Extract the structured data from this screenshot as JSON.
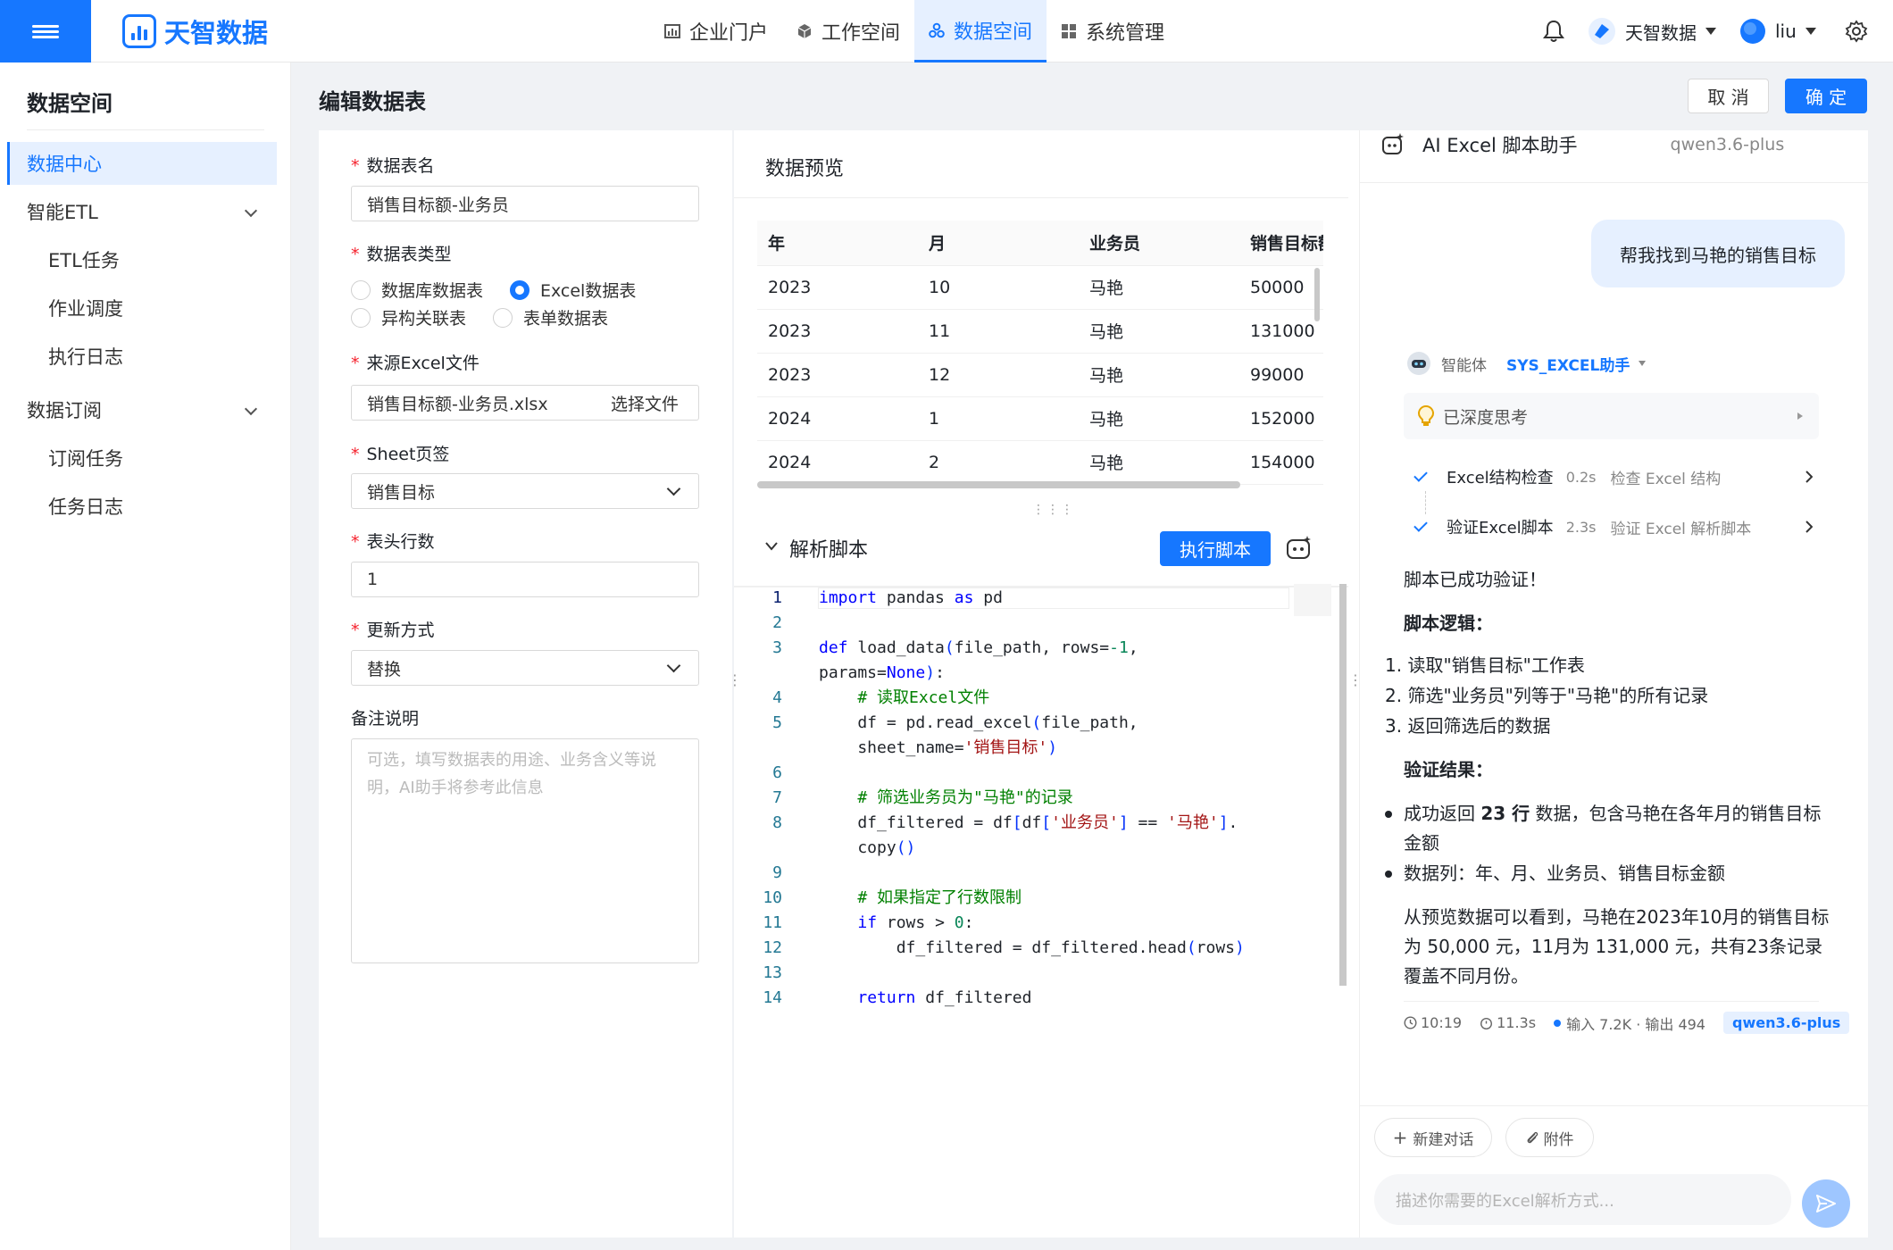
{
  "brand": {
    "name": "天智数据"
  },
  "nav": {
    "items": [
      {
        "label": "企业门户",
        "icon": "chart-bar-icon"
      },
      {
        "label": "工作空间",
        "icon": "cube-icon"
      },
      {
        "label": "数据空间",
        "icon": "cluster-icon",
        "active": true
      },
      {
        "label": "系统管理",
        "icon": "grid-icon"
      }
    ]
  },
  "header": {
    "org": "天智数据",
    "user": "liu"
  },
  "sidebar": {
    "title": "数据空间",
    "items": [
      {
        "label": "数据中心"
      },
      {
        "label": "智能ETL"
      },
      {
        "label": "ETL任务"
      },
      {
        "label": "作业调度"
      },
      {
        "label": "执行日志"
      },
      {
        "label": "数据订阅"
      },
      {
        "label": "订阅任务"
      },
      {
        "label": "任务日志"
      }
    ]
  },
  "page": {
    "title": "编辑数据表",
    "cancel": "取 消",
    "confirm": "确 定"
  },
  "form": {
    "name_label": "数据表名",
    "name_value": "销售目标额-业务员",
    "type_label": "数据表类型",
    "types": [
      "数据库数据表",
      "Excel数据表",
      "异构关联表",
      "表单数据表"
    ],
    "selected_type": "Excel数据表",
    "file_label": "来源Excel文件",
    "file_value": "销售目标额-业务员.xlsx",
    "file_button": "选择文件",
    "sheet_label": "Sheet页签",
    "sheet_value": "销售目标",
    "header_rows_label": "表头行数",
    "header_rows_value": "1",
    "update_label": "更新方式",
    "update_value": "替换",
    "remark_label": "备注说明",
    "remark_placeholder": "可选，填写数据表的用途、业务含义等说明，AI助手将参考此信息"
  },
  "preview": {
    "title": "数据预览",
    "columns": [
      "年",
      "月",
      "业务员",
      "销售目标额"
    ],
    "rows": [
      [
        "2023",
        "10",
        "马艳",
        "50000"
      ],
      [
        "2023",
        "11",
        "马艳",
        "131000"
      ],
      [
        "2023",
        "12",
        "马艳",
        "99000"
      ],
      [
        "2024",
        "1",
        "马艳",
        "152000"
      ],
      [
        "2024",
        "2",
        "马艳",
        "154000"
      ]
    ]
  },
  "script": {
    "title": "解析脚本",
    "run_button": "执行脚本",
    "lines": [
      "import pandas as pd",
      "",
      "def load_data(file_path, rows=-1, params=None):",
      "    # 读取Excel文件",
      "    df = pd.read_excel(file_path, sheet_name='销售目标')",
      "",
      "    # 筛选业务员为\"马艳\"的记录",
      "    df_filtered = df[df['业务员'] == '马艳'].copy()",
      "",
      "    # 如果指定了行数限制",
      "    if rows > 0:",
      "        df_filtered = df_filtered.head(rows)",
      "",
      "    return df_filtered"
    ]
  },
  "assistant": {
    "title": "AI Excel 脚本助手",
    "model": "qwen3.6-plus",
    "user_message": "帮我找到马艳的销售目标",
    "agent_label": "智能体",
    "agent_name": "SYS_EXCEL助手",
    "thinking": "已深度思考",
    "steps": [
      {
        "name": "Excel结构检查",
        "time": "0.2s",
        "desc": "检查 Excel 结构"
      },
      {
        "name": "验证Excel脚本",
        "time": "2.3s",
        "desc": "验证 Excel 解析脚本"
      }
    ],
    "success": "脚本已成功验证！",
    "logic_title": "脚本逻辑：",
    "logic": [
      "读取\"销售目标\"工作表",
      "筛选\"业务员\"列等于\"马艳\"的所有记录",
      "返回筛选后的数据"
    ],
    "verify_title": "验证结果：",
    "verify_1_pre": "成功返回 ",
    "verify_1_bold": "23 行",
    "verify_1_post": " 数据，包含马艳在各年月的销售目标金额",
    "verify_2": "数据列：年、月、业务员、销售目标金额",
    "summary": "从预览数据可以看到，马艳在2023年10月的销售目标为 50,000 元，11月为 131,000 元，共有23条记录覆盖不同月份。",
    "meta_time": "10:19",
    "meta_duration": "11.3s",
    "meta_tokens": "输入 7.2K · 输出 494",
    "meta_model": "qwen3.6-plus",
    "new_chat": "新建对话",
    "attach": "附件",
    "input_placeholder": "描述你需要的Excel解析方式..."
  },
  "colors": {
    "primary": "#1677ff",
    "required": "#f5222d"
  }
}
